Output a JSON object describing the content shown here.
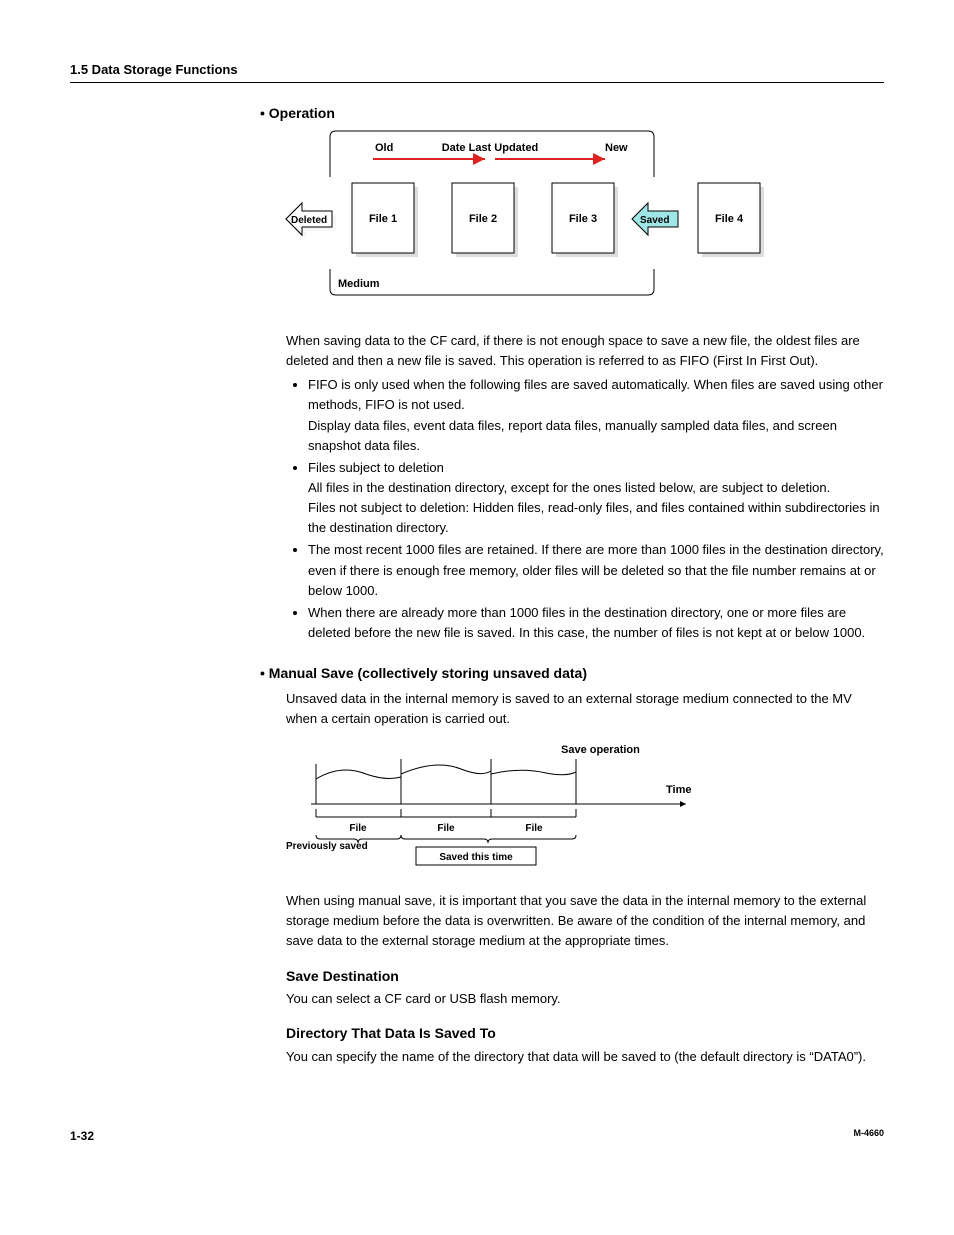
{
  "header": {
    "section": "1.5  Data Storage Functions"
  },
  "operation": {
    "title": "Operation",
    "diagram": {
      "old": "Old",
      "dateLastUpdated": "Date Last Updated",
      "new": "New",
      "deleted": "Deleted",
      "file1": "File 1",
      "file2": "File 2",
      "file3": "File 3",
      "file4": "File 4",
      "saved": "Saved",
      "medium": "Medium"
    },
    "intro": "When saving data to the CF card, if there is not enough space to save a new file, the oldest files are deleted and then a new file is saved. This operation is referred to as FIFO (First In First Out).",
    "bullets": {
      "b1a": "FIFO is only used when the following files are saved automatically. When files are saved using other methods, FIFO is not used.",
      "b1b": "Display data files, event data files, report data files, manually sampled data files, and screen snapshot data files.",
      "b2a": "Files subject to deletion",
      "b2b": "All files in the destination directory, except for the ones listed below, are subject to deletion.",
      "b2c": "Files not subject to deletion: Hidden files, read-only files, and files contained within subdirectories in the destination directory.",
      "b3": "The most recent 1000 files are retained. If there are more than 1000 files in the destination directory, even if there is enough free memory, older files will be deleted so that the file number remains at or below 1000.",
      "b4": "When there are already more than 1000 files in the destination directory, one or more files are deleted before the new file is saved. In this case, the number of files is not kept at or below 1000."
    }
  },
  "manualSave": {
    "title": "Manual Save (collectively storing unsaved data)",
    "intro": "Unsaved data in the internal memory is saved to an external storage medium connected to the MV when a certain operation is carried out.",
    "diagram": {
      "saveOperation": "Save operation",
      "time": "Time",
      "file": "File",
      "previouslySaved": "Previously saved",
      "savedThisTime": "Saved this time"
    },
    "note": "When using manual save, it is important that you save the data in the internal memory to the external storage medium before the data is overwritten. Be aware of the condition of the internal memory, and save data to the external storage medium at the appropriate times."
  },
  "saveDestination": {
    "title": "Save Destination",
    "body": "You can select a CF card or USB flash memory."
  },
  "directory": {
    "title": "Directory That Data Is Saved To",
    "body": "You can specify the name of the directory that data will be saved to (the default directory is “DATA0”)."
  },
  "footer": {
    "page": "1-32",
    "doc": "M-4660"
  }
}
